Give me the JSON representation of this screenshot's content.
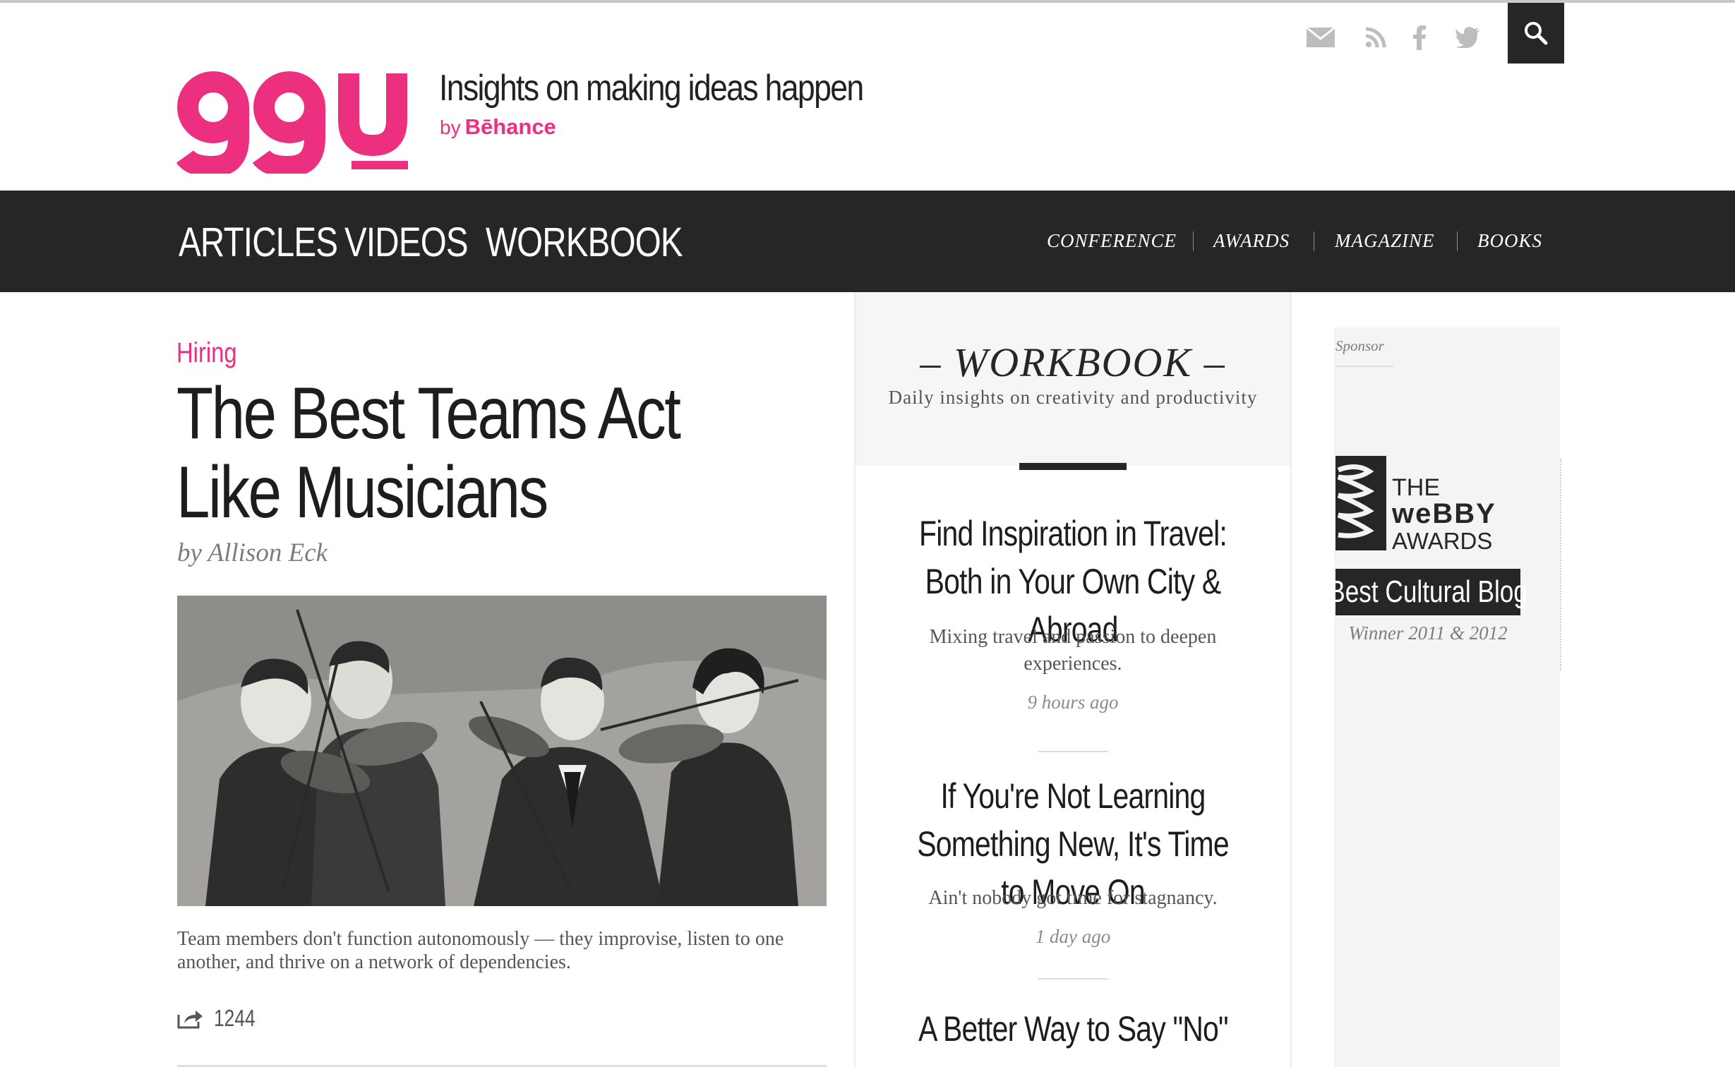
{
  "brand": {
    "logo": "99u",
    "tagline": "Insights on making ideas happen",
    "by": "by",
    "parent": "Bēhance",
    "accent": "#ed2f80",
    "dark": "#262626"
  },
  "header_icons": [
    "mail-icon",
    "rss-icon",
    "facebook-icon",
    "twitter-icon",
    "search-icon"
  ],
  "nav": {
    "main": [
      "ARTICLES",
      "VIDEOS",
      "WORKBOOK"
    ],
    "secondary": [
      "CONFERENCE",
      "AWARDS",
      "MAGAZINE",
      "BOOKS"
    ]
  },
  "article": {
    "category": "Hiring",
    "title": "The Best Teams Act Like Musicians",
    "author": "by Allison Eck",
    "excerpt": "Team members don't function autonomously — they improvise, listen to one another, and thrive on a network of dependencies.",
    "share_count": "1244"
  },
  "workbook": {
    "title": "– WORKBOOK –",
    "subtitle": "Daily insights on creativity and productivity",
    "items": [
      {
        "title": "Find Inspiration in Travel: Both in Your Own City & Abroad",
        "desc": "Mixing travel and passion to deepen experiences.",
        "time": "9 hours ago"
      },
      {
        "title": "If You're Not Learning Something New, It's Time to Move On",
        "desc": "Ain't nobody got time for stagnancy.",
        "time": "1 day ago"
      },
      {
        "title": "A Better Way to Say \"No\""
      }
    ]
  },
  "sponsor": {
    "label": "Sponsor",
    "award_the": "THE",
    "award_name": "weBBY",
    "award_word": "AWARDS",
    "badge": "Best Cultural Blog",
    "winner": "Winner 2011 & 2012"
  }
}
